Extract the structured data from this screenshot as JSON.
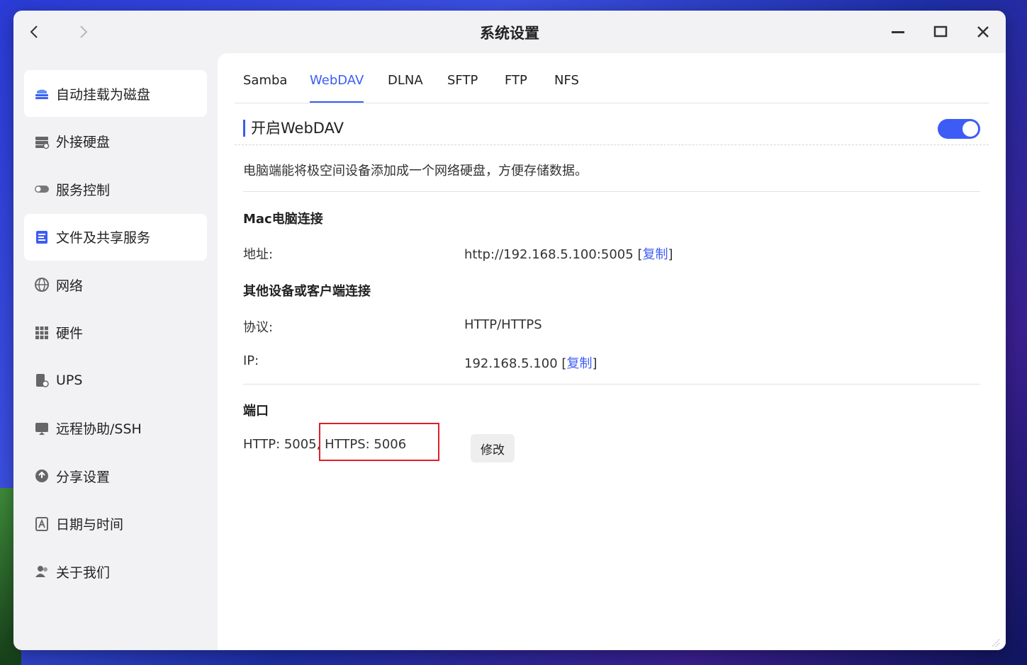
{
  "window": {
    "title": "系统设置"
  },
  "sidebar": {
    "items": [
      {
        "label": "自动挂载为磁盘",
        "icon": "disk-stack-icon",
        "active": true
      },
      {
        "label": "外接硬盘",
        "icon": "external-drive-icon",
        "active": false
      },
      {
        "label": "服务控制",
        "icon": "toggle-icon",
        "active": false
      },
      {
        "label": "文件及共享服务",
        "icon": "file-share-icon",
        "active": true
      },
      {
        "label": "网络",
        "icon": "globe-icon",
        "active": false
      },
      {
        "label": "硬件",
        "icon": "grid-icon",
        "active": false
      },
      {
        "label": "UPS",
        "icon": "ups-icon",
        "active": false
      },
      {
        "label": "远程协助/SSH",
        "icon": "monitor-icon",
        "active": false
      },
      {
        "label": "分享设置",
        "icon": "share-icon",
        "active": false
      },
      {
        "label": "日期与时间",
        "icon": "calendar-icon",
        "active": false
      },
      {
        "label": "关于我们",
        "icon": "users-icon",
        "active": false
      }
    ]
  },
  "tabs": [
    {
      "label": "Samba",
      "active": false
    },
    {
      "label": "WebDAV",
      "active": true
    },
    {
      "label": "DLNA",
      "active": false
    },
    {
      "label": "SFTP",
      "active": false
    },
    {
      "label": "FTP",
      "active": false
    },
    {
      "label": "NFS",
      "active": false
    }
  ],
  "webdav": {
    "enable_label": "开启WebDAV",
    "enabled": true,
    "description": "电脑端能将极空间设备添加成一个网络硬盘，方便存储数据。",
    "mac_section": "Mac电脑连接",
    "address_label": "地址:",
    "address_value": "http://192.168.5.100:5005",
    "other_section": "其他设备或客户端连接",
    "protocol_label": "协议:",
    "protocol_value": "HTTP/HTTPS",
    "ip_label": "IP:",
    "ip_value": "192.168.5.100",
    "copy_label": "复制",
    "bracket_open": "[",
    "bracket_close": "]",
    "port_section": "端口",
    "http_port": "HTTP: 5005",
    "separator": ", ",
    "https_port": "HTTPS: 5006",
    "edit_label": "修改"
  },
  "colors": {
    "accent": "#3d5cf5",
    "highlight": "#e01e2a"
  }
}
